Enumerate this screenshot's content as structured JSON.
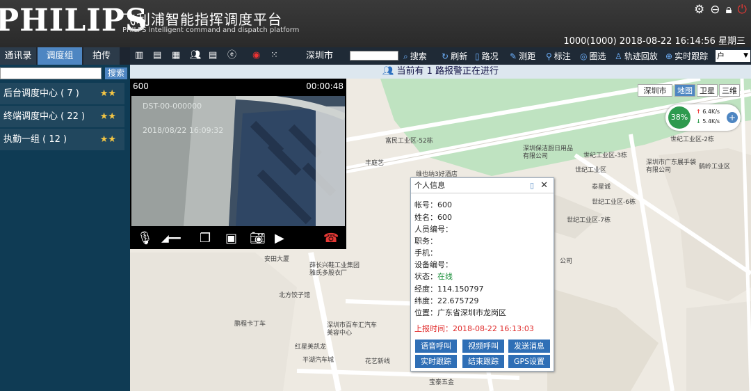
{
  "header": {
    "logo": "PHILIPS",
    "title": "飞利浦智能指挥调度平台",
    "subtitle": "PHILPS intelligent command and dispatch platform",
    "user_status": "1000(1000)  2018-08-22 16:14:56  星期三",
    "icons": [
      "gear-icon",
      "minimize-icon",
      "lock-icon",
      "power-icon"
    ]
  },
  "left_panel": {
    "tabs": [
      "通讯录",
      "调度组",
      "拍传"
    ],
    "active_tab": "调度组",
    "search_placeholder": "",
    "search_button": "搜索",
    "groups": [
      {
        "label": "后台调度中心 ( 7 )",
        "stars": "★★"
      },
      {
        "label": "终端调度中心 ( 22 )",
        "stars": "★★"
      },
      {
        "label": "执勤一组 ( 12 )",
        "stars": "★★"
      }
    ]
  },
  "toolbar": {
    "city": "深圳市",
    "city_input": "",
    "search": "搜索",
    "refresh": "刷新",
    "route": "路况",
    "measure": "测距",
    "mark": "标注",
    "circle_select": "圈选",
    "track_replay": "轨迹回放",
    "realtime_track": "实时跟踪",
    "dropdown_value": "户"
  },
  "alert": {
    "text": "当前有 1 路报警正在进行"
  },
  "map": {
    "map_types": [
      "深圳市",
      "地图",
      "卫星",
      "三维"
    ],
    "active_map_type": "地图",
    "network": {
      "percent": "38%",
      "up": "6.4K/s",
      "down": "5.4K/s"
    },
    "labels": [
      "富民工业区-52栋",
      "丰庭艺",
      "维也纳3好酒店",
      "深圳保洁厨日用品有限公司",
      "世纪工业区-3栋",
      "世纪工业区",
      "世纪工业区-2栋",
      "深圳市广东展手袋有限公司",
      "鹤岭工业区",
      "泰星诚",
      "世纪工业区-6栋",
      "世纪工业区-7栋",
      "安田大厦",
      "薛长兴鞋工业集团雅氏多股衣厂",
      "北方饺子馆",
      "鹏程卡丁车",
      "深圳市百车汇汽车美容中心",
      "红星美凯龙",
      "平湖汽车城",
      "花艺新线",
      "宝泰五金",
      "公司"
    ]
  },
  "video": {
    "title": "600",
    "time": "00:00:48",
    "osd_id": "DST-00-000000",
    "osd_time": "2018/08/22 16:09:32"
  },
  "popup": {
    "title": "个人信息",
    "rows": [
      {
        "label": "帐号：",
        "value": "600"
      },
      {
        "label": "姓名：",
        "value": "600"
      },
      {
        "label": "人员编号：",
        "value": ""
      },
      {
        "label": "职务：",
        "value": ""
      },
      {
        "label": "手机：",
        "value": ""
      },
      {
        "label": "设备编号：",
        "value": ""
      },
      {
        "label": "状态：",
        "value": "在线"
      },
      {
        "label": "经度：",
        "value": "114.150797"
      },
      {
        "label": "纬度：",
        "value": "22.675729"
      },
      {
        "label": "位置：",
        "value": "广东省深圳市龙岗区"
      }
    ],
    "report_time_label": "上报时间：",
    "report_time": "2018-08-22 16:13:03",
    "buttons": [
      "语音呼叫",
      "视频呼叫",
      "发送消息",
      "实时跟踪",
      "结束跟踪",
      "GPS设置"
    ]
  }
}
